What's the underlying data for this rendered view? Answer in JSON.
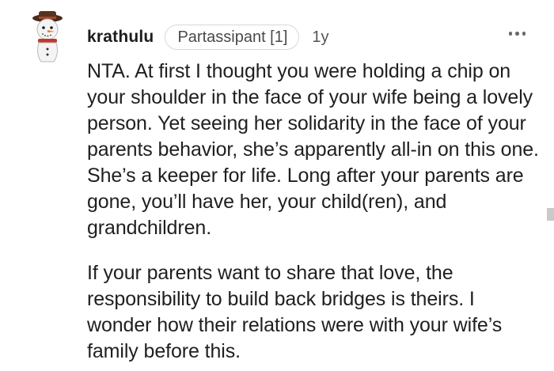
{
  "comment": {
    "author": "krathulu",
    "flair": "Partassipant [1]",
    "age": "1y",
    "paragraphs": [
      "NTA. At first I thought you were holding a chip on your shoulder in the face of your wife being a lovely person. Yet seeing her solidarity in the face of your parents behavior, she’s apparently all-in on this one. She’s a keeper for life. Long after your parents are gone, you’ll have her, your child(ren), and grandchildren.",
      "If your parents want to share that love, the responsibility to build back bridges is theirs. I wonder how their relations were with your wife’s family before this."
    ]
  },
  "icons": {
    "avatar": "snowman-avatar-icon",
    "more": "more-options-icon"
  },
  "colors": {
    "text": "#1c1c1c",
    "flair_border": "#d8d8d8",
    "muted": "#555555"
  }
}
